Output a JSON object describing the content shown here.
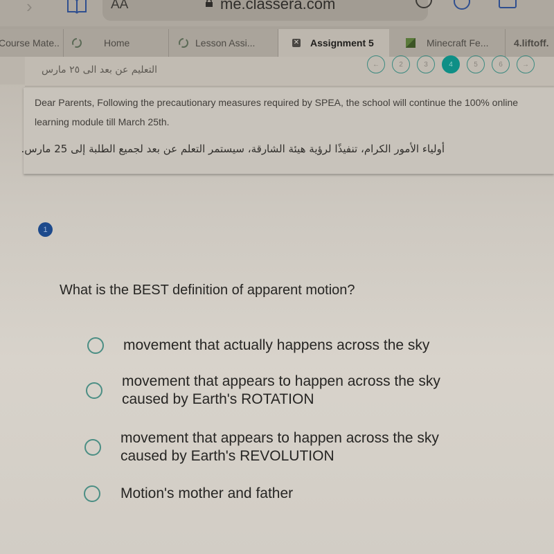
{
  "browser": {
    "address_text_size": "AA",
    "url": "me.classera.com",
    "tabs": [
      {
        "label": "Course Mate..",
        "active": false
      },
      {
        "label": "Home",
        "active": false
      },
      {
        "label": "Lesson Assi...",
        "active": false
      },
      {
        "label": "Assignment 5",
        "active": true
      },
      {
        "label": "Minecraft Fe...",
        "active": false
      },
      {
        "label": "4.liftoff.",
        "active": false
      }
    ]
  },
  "subheader": {
    "arabic_label": "التعليم عن بعد الى ٢٥ مارس",
    "pager": {
      "prev": "←",
      "pages": [
        "2",
        "3",
        "4",
        "5",
        "6"
      ],
      "current": "4",
      "next": "→"
    }
  },
  "notice": {
    "english": "Dear Parents, Following the precautionary measures required by SPEA, the school will continue the 100% online learning module till March 25th.",
    "arabic": "أولياء الأمور الكرام، تنفيذًا لرؤية هيئة الشارقة، سيستمر التعلم عن بعد لجميع الطلبة إلى 25 مارس."
  },
  "question": {
    "number": "1",
    "text": "What is the BEST definition of apparent motion?",
    "options": [
      {
        "line1": "movement that actually happens across the sky",
        "line2": "",
        "selected": false
      },
      {
        "line1": "movement that appears to happen across the sky",
        "line2": "caused by Earth's ROTATION",
        "selected": false
      },
      {
        "line1": "movement that appears to happen across the sky",
        "line2": "caused by Earth's REVOLUTION",
        "selected": false
      },
      {
        "line1": "Motion's mother and father",
        "line2": "",
        "selected": false
      }
    ]
  },
  "colors": {
    "accent_teal": "#0f8f86",
    "badge_blue": "#1d4a8c"
  }
}
